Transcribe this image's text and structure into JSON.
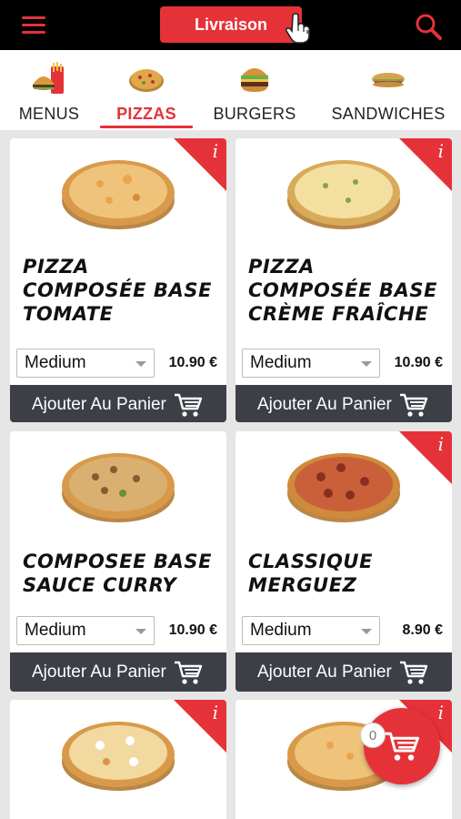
{
  "topbar": {
    "delivery_label": "Livraison",
    "accent_color": "#e53238"
  },
  "categories": [
    {
      "label": "MENUS",
      "icon": "menu-combo-icon",
      "active": false
    },
    {
      "label": "PIZZAS",
      "icon": "pizza-icon",
      "active": true
    },
    {
      "label": "BURGERS",
      "icon": "burger-icon",
      "active": false
    },
    {
      "label": "SANDWICHES",
      "icon": "sandwich-icon",
      "active": false
    }
  ],
  "products": [
    {
      "name": "PIZZA COMPOSÉE BASE TOMATE",
      "size": "Medium",
      "price": "10.90 €",
      "add_label": "Ajouter Au Panier",
      "info": "i"
    },
    {
      "name": "PIZZA COMPOSÉE BASE CRÈME FRAÎCHE",
      "size": "Medium",
      "price": "10.90 €",
      "add_label": "Ajouter Au Panier",
      "info": "i"
    },
    {
      "name": "COMPOSEE BASE SAUCE CURRY",
      "size": "Medium",
      "price": "10.90 €",
      "add_label": "Ajouter Au Panier",
      "info": "i"
    },
    {
      "name": "CLASSIQUE MERGUEZ",
      "size": "Medium",
      "price": "8.90 €",
      "add_label": "Ajouter Au Panier",
      "info": "i"
    },
    {
      "name": "",
      "size": "",
      "price": "",
      "add_label": "",
      "info": "i"
    },
    {
      "name": "",
      "size": "",
      "price": "",
      "add_label": "",
      "info": "i"
    }
  ],
  "cart": {
    "count": "0"
  }
}
